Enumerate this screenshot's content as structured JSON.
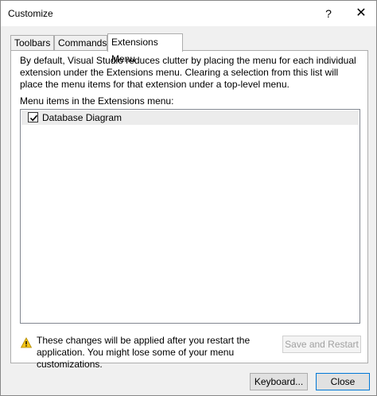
{
  "window": {
    "title": "Customize",
    "help_glyph": "?",
    "close_glyph": "✕"
  },
  "tabs": [
    {
      "label": "Toolbars",
      "active": false
    },
    {
      "label": "Commands",
      "active": false
    },
    {
      "label": "Extensions Menu",
      "active": true
    }
  ],
  "extensions": {
    "description": "By default, Visual Studio reduces clutter by placing the menu for each individual extension under the Extensions menu. Clearing a selection from this list will place the menu items for that extension under a top-level menu.",
    "list_label": "Menu items in the Extensions menu:",
    "items": [
      {
        "label": "Database Diagram",
        "checked": true
      }
    ],
    "warning": "These changes will be applied after you restart the application. You might lose some of your menu customizations.",
    "save_restart_label": "Save and Restart"
  },
  "footer": {
    "keyboard_label": "Keyboard...",
    "close_label": "Close"
  },
  "colors": {
    "accent": "#0078d7",
    "warning_yellow": "#f5c518"
  },
  "icons": {
    "warning": "warning-triangle-icon",
    "check": "checkmark-icon"
  }
}
